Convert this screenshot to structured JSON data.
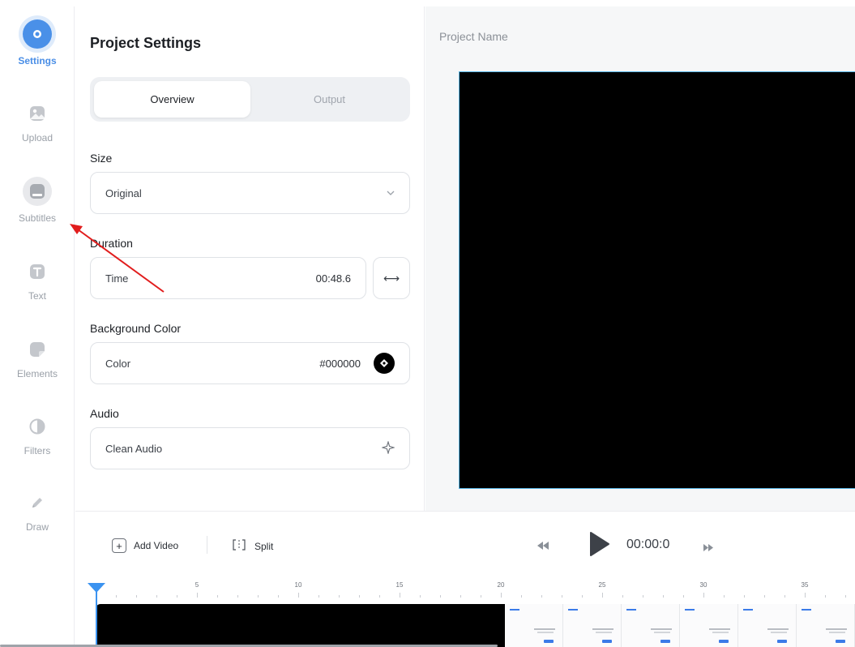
{
  "sidebar": {
    "items": [
      {
        "label": "Settings",
        "icon": "settings-icon",
        "active": true
      },
      {
        "label": "Upload",
        "icon": "image-upload-icon"
      },
      {
        "label": "Subtitles",
        "icon": "subtitles-icon"
      },
      {
        "label": "Text",
        "icon": "text-icon"
      },
      {
        "label": "Elements",
        "icon": "sticker-icon"
      },
      {
        "label": "Filters",
        "icon": "half-circle-icon"
      },
      {
        "label": "Draw",
        "icon": "pencil-icon"
      }
    ]
  },
  "panel": {
    "title": "Project Settings",
    "tabs": [
      {
        "label": "Overview",
        "selected": true
      },
      {
        "label": "Output",
        "selected": false
      }
    ],
    "size": {
      "label": "Size",
      "value": "Original"
    },
    "duration": {
      "label": "Duration",
      "field_label": "Time",
      "value": "00:48.6"
    },
    "background": {
      "label": "Background Color",
      "field_label": "Color",
      "value": "#000000"
    },
    "audio": {
      "label": "Audio",
      "value": "Clean Audio"
    }
  },
  "preview": {
    "project_name_placeholder": "Project Name",
    "canvas_color": "#000000",
    "border_color": "#5ab8e8"
  },
  "timeline": {
    "add_video_label": "Add Video",
    "split_label": "Split",
    "timecode": "00:00:0",
    "ruler_labels": [
      "5",
      "10",
      "15",
      "20",
      "25",
      "30",
      "35"
    ],
    "accent_color": "#3b93f0"
  }
}
